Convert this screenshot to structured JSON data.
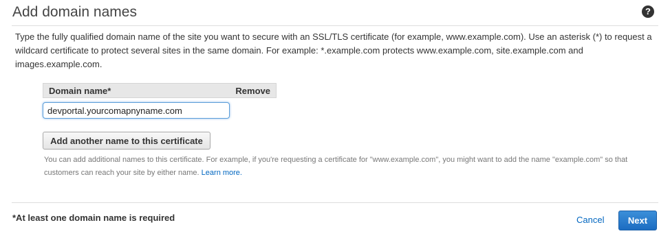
{
  "header": {
    "title": "Add domain names",
    "help_icon": "question-mark"
  },
  "intro_text": "Type the fully qualified domain name of the site you want to secure with an SSL/TLS certificate (for example, www.example.com). Use an asterisk (*) to request a wildcard certificate to protect several sites in the same domain. For example: *.example.com protects www.example.com, site.example.com and images.example.com.",
  "domain_table": {
    "columns": [
      "Domain name*",
      "Remove"
    ],
    "rows": [
      {
        "domain": "devportal.yourcomapnyname.com"
      }
    ]
  },
  "add_button_label": "Add another name to this certificate",
  "hint": {
    "text": "You can add additional names to this certificate. For example, if you're requesting a certificate for \"www.example.com\", you might want to add the name \"example.com\" so that customers can reach your site by either name. ",
    "link": "Learn more."
  },
  "footer": {
    "required_note": "*At least one domain name is required",
    "cancel_label": "Cancel",
    "next_label": "Next"
  },
  "colors": {
    "link": "#0066c0",
    "primary_button": "#1c6cc1",
    "input_focus": "#5b9dd9"
  }
}
